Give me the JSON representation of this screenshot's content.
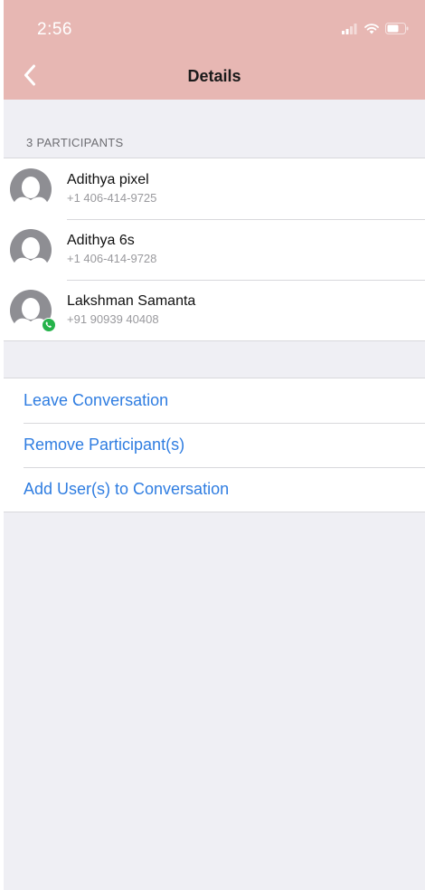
{
  "status_bar": {
    "time": "2:56",
    "icons": [
      "cellular-signal-icon",
      "wifi-icon",
      "battery-icon"
    ]
  },
  "nav": {
    "title": "Details",
    "back_icon": "chevron-left-icon"
  },
  "participants_header": "3 PARTICIPANTS",
  "participants": [
    {
      "name": "Adithya pixel",
      "phone": "+1 406-414-9725",
      "badge": null
    },
    {
      "name": "Adithya 6s",
      "phone": "+1 406-414-9728",
      "badge": null
    },
    {
      "name": "Lakshman Samanta",
      "phone": "+91 90939 40408",
      "badge": "whatsapp-icon"
    }
  ],
  "actions": [
    {
      "label": "Leave Conversation"
    },
    {
      "label": "Remove Participant(s)"
    },
    {
      "label": "Add User(s) to Conversation"
    }
  ],
  "colors": {
    "header_bg": "#e7b7b3",
    "action_text": "#2f7de1",
    "page_bg": "#efeff4",
    "avatar": "#8e8e93",
    "whatsapp_green": "#25b34a"
  }
}
